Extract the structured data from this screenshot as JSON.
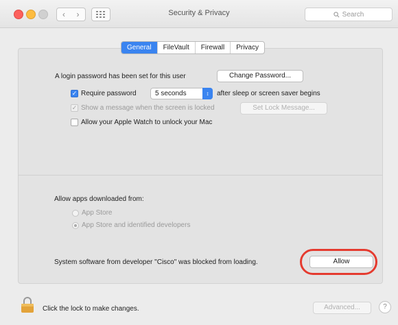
{
  "window": {
    "title": "Security & Privacy",
    "search_placeholder": "Search"
  },
  "tabs": [
    {
      "label": "General",
      "active": true
    },
    {
      "label": "FileVault",
      "active": false
    },
    {
      "label": "Firewall",
      "active": false
    },
    {
      "label": "Privacy",
      "active": false
    }
  ],
  "general": {
    "login_text": "A login password has been set for this user",
    "change_password_label": "Change Password...",
    "require_password_label": "Require password",
    "require_password_checked": true,
    "require_password_delay": "5 seconds",
    "after_sleep_text": "after sleep or screen saver begins",
    "show_message_label": "Show a message when the screen is locked",
    "set_lock_message_label": "Set Lock Message...",
    "apple_watch_label": "Allow your Apple Watch to unlock your Mac"
  },
  "downloads": {
    "heading": "Allow apps downloaded from:",
    "options": [
      {
        "label": "App Store",
        "selected": false
      },
      {
        "label": "App Store and identified developers",
        "selected": true
      }
    ]
  },
  "blocked": {
    "message": "System software from developer \"Cisco\" was blocked from loading.",
    "allow_label": "Allow"
  },
  "footer": {
    "lock_text": "Click the lock to make changes.",
    "advanced_label": "Advanced...",
    "help_label": "?"
  },
  "colors": {
    "accent": "#3a84f0",
    "highlight": "#e53b2f",
    "lock": "#e3a33a"
  },
  "icons": [
    "close-button",
    "minimize-button",
    "zoom-button",
    "chevron-left-icon",
    "chevron-right-icon",
    "grid-icon",
    "search-icon",
    "lock-icon"
  ]
}
